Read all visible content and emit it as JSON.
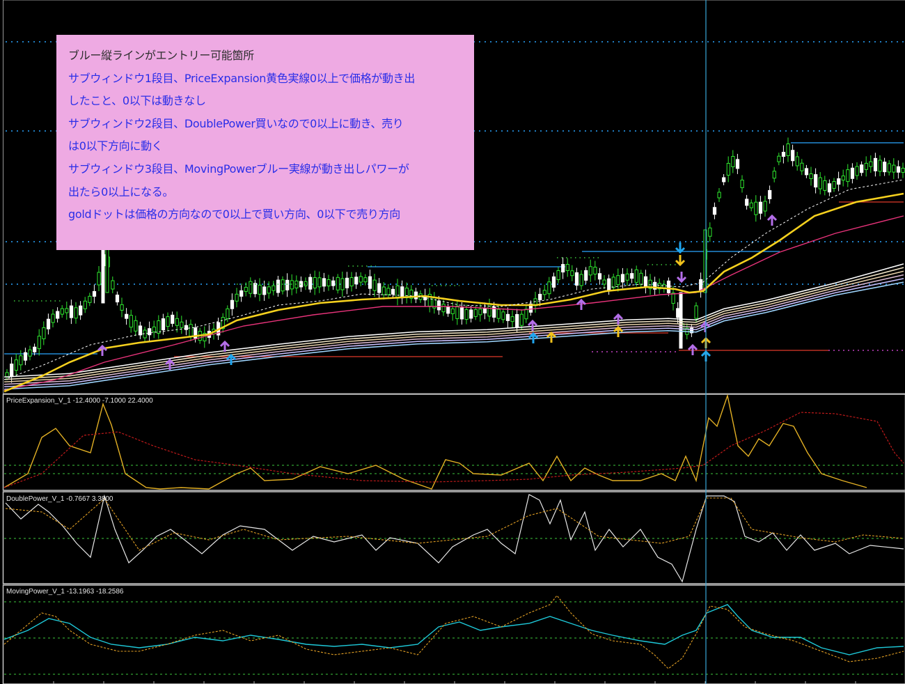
{
  "colors": {
    "background": "#000000",
    "pane_separator": "#c8c8c8",
    "annotation_bg": "#eeaae3",
    "annotation_first_line": "#2e2e2e",
    "annotation_text": "#2a2ee8",
    "candle_bull": "#2ee82e",
    "candle_bear": "#ffffff",
    "vertical_entry_line": "#3aa6d8",
    "yellow_ma": "#f6d11e",
    "magenta_ma": "#e8337a",
    "blue_level": "#2aa6ff",
    "red_level": "#e03a2a",
    "up_arrow_cyan": "#1fa5ee",
    "up_arrow_yellow": "#f1c21c",
    "up_arrow_purple": "#b46ee8"
  },
  "icons": {
    "buy_arrow": "up-arrow-icon",
    "sell_arrow": "down-arrow-icon"
  },
  "panes": {
    "price_expansion": "PriceExpansion_V_1 -12.4000 -7.1000 22.4000",
    "double_power": "DoublePower_V_1 -0.7667 3.3800",
    "moving_power": "MovingPower_V_1 -13.1963 -18.2586"
  },
  "annotation": {
    "lines": [
      "ブルー縦ラインがエントリー可能箇所",
      "サブウィンドウ1段目、PriceExpansion黄色実線0以上で価格が動き出",
      "したこと、0以下は動きなし",
      "サブウィンドウ2段目、DoublePower買いなので0以上に動き、売り",
      "は0以下方向に動く",
      "サブウィンドウ3段目、MovingPowerブルー実線が動き出しパワーが",
      "出たら0以上になる。",
      "goldドットは価格の方向なので0以上で買い方向、0以下で売り方向"
    ]
  }
}
